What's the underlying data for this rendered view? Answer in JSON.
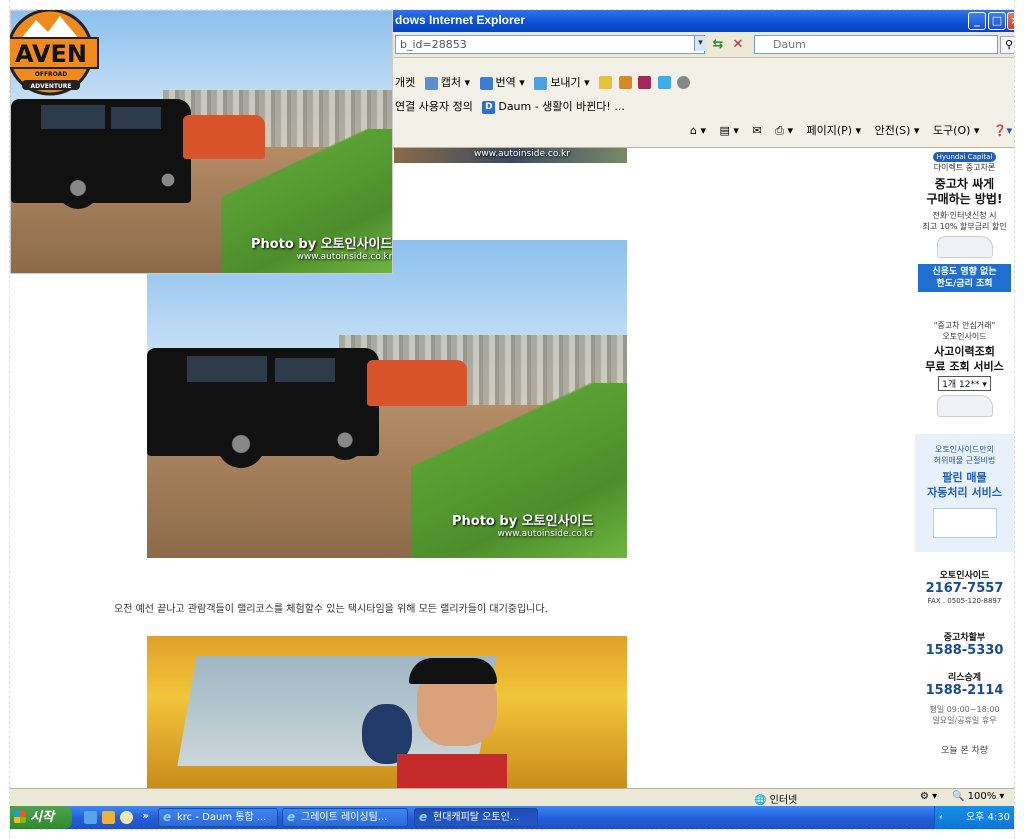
{
  "window": {
    "title": "dows Internet Explorer"
  },
  "address_bar": {
    "url": "b_id=28853",
    "search_value": "Daum",
    "search_logo": "D"
  },
  "toolbar": {
    "row1": [
      "개켓",
      "캡처",
      "번역",
      "보내기"
    ],
    "row2": [
      "연결 사용자 정의",
      "Daum - 생활이 바뀐다! ..."
    ],
    "commands": [
      "페이지(P)",
      "안전(S)",
      "도구(O)"
    ]
  },
  "photo_watermark": {
    "line1": "Photo by  오토인사이드",
    "line2": "www.autoinside.co.kr"
  },
  "strip_watermark": "www.autoinside.co.kr",
  "overlay_logo": {
    "brand": "AVEN",
    "line1": "OFFROAD",
    "line2": "ADVENTURE"
  },
  "caption": "오전 예선 끝나고 관람객들이 랠리코스를 체험할수 있는 택시타임을 위해 모든 랠리카들이 대기중입니다.",
  "sidebar": {
    "capital_badge": "Hyundai Capital",
    "capital_sub": "다이렉트 중고차론",
    "ad1_title": "중고차 싸게\n구매하는 방법!",
    "ad1_sub": "전화·인터넷신청 시\n최고 10% 할부금리 할인",
    "ad1_btn": "신용도 영향 없는\n한도/금리 조회",
    "ad2_tag": "\"중고차 안심거래\"\n오토인사이드",
    "ad2_title": "사고이력조회\n무료 조회 서비스",
    "ad2_select": "1개 12**",
    "ad3_sub": "오토인사이드만의\n허위매물 근절비법",
    "ad3_title": "팔린 매물\n자동처리 서비스",
    "contact_name": "오토인사이드",
    "contact_phone": "2167-7557",
    "contact_fax": "FAX . 0505-120-8897",
    "dept1_label": "중고차할부",
    "dept1_phone": "1588-5330",
    "dept2_label": "리스승계",
    "dept2_phone": "1588-2114",
    "hours": "평일 09:00~18:00\n일요일/공휴일 휴무",
    "recent": "오늘 본 차량"
  },
  "statusbar": {
    "zone": "인터넷",
    "zoom": "100%"
  },
  "taskbar": {
    "start": "시작",
    "tasks": [
      "krc - Daum 통합 ...",
      "그레이트 레이싱팀...",
      "현대캐피탈 오토인..."
    ],
    "clock": "오후 4:30"
  }
}
